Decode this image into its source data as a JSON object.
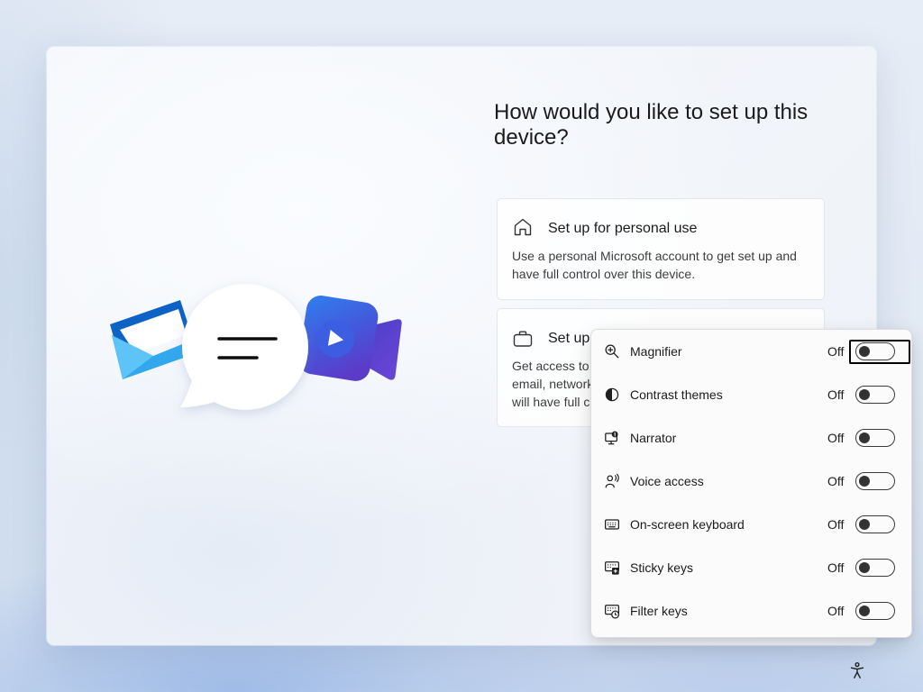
{
  "header": {
    "title": "How would you like to set up this device?"
  },
  "setup_options": [
    {
      "icon": "home-icon",
      "title": "Set up for personal use",
      "description": "Use a personal Microsoft account to get set up and have full control over this device."
    },
    {
      "icon": "briefcase-icon",
      "title": "Set up",
      "description_lines": [
        "Get access to",
        "email, network",
        "will have full c"
      ]
    }
  ],
  "accessibility_flyout": {
    "items": [
      {
        "label": "Magnifier",
        "icon": "magnifier-icon",
        "state_label": "Off",
        "on": false,
        "focused": true
      },
      {
        "label": "Contrast themes",
        "icon": "contrast-icon",
        "state_label": "Off",
        "on": false,
        "focused": false
      },
      {
        "label": "Narrator",
        "icon": "narrator-icon",
        "state_label": "Off",
        "on": false,
        "focused": false
      },
      {
        "label": "Voice access",
        "icon": "voice-access-icon",
        "state_label": "Off",
        "on": false,
        "focused": false
      },
      {
        "label": "On-screen keyboard",
        "icon": "keyboard-icon",
        "state_label": "Off",
        "on": false,
        "focused": false
      },
      {
        "label": "Sticky keys",
        "icon": "sticky-keys-icon",
        "state_label": "Off",
        "on": false,
        "focused": false
      },
      {
        "label": "Filter keys",
        "icon": "filter-keys-icon",
        "state_label": "Off",
        "on": false,
        "focused": false
      }
    ]
  },
  "illustration": {
    "icons": [
      "mail-icon",
      "chat-bubble-icon",
      "video-camera-icon"
    ]
  },
  "corner": {
    "accessibility_button_icon": "accessibility-icon"
  },
  "colors": {
    "text": "#1b1b1b",
    "secondary_text": "#3d3d3d",
    "card_border": "#e3e7ed",
    "toggle_off": "#333333",
    "focus_ring": "#000000",
    "mail_blue": "#0d62c6",
    "mail_cyan": "#31a8ee",
    "camera_blue": "#2f80ee",
    "camera_purple": "#5b3cc8"
  }
}
